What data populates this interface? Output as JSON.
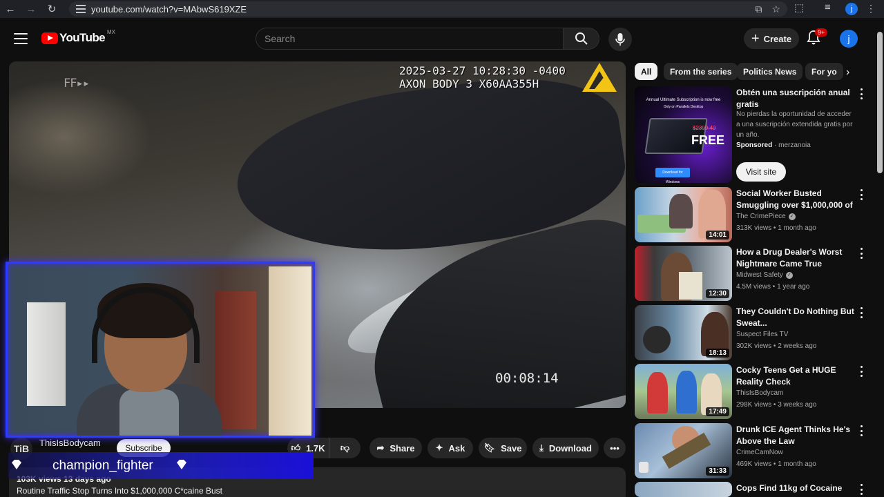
{
  "browser": {
    "url": "youtube.com/watch?v=MAbwS619XZE",
    "profile_initial": "j"
  },
  "header": {
    "logo_text": "YouTube",
    "country_code": "MX",
    "search_placeholder": "Search",
    "create_label": "Create",
    "notifications_badge": "9+",
    "avatar_initial": "j"
  },
  "video": {
    "overlay_ff": "FF▸▸",
    "timestamp_line1": "2025-03-27 10:28:30 -0400",
    "timestamp_line2": "AXON BODY 3 X60AA355H",
    "elapsed": "00:08:14",
    "accent_color": "#f2c416"
  },
  "stream_overlay": {
    "username": "champion_fighter",
    "frame_color": "#2b3cff"
  },
  "below_video": {
    "channel_initials": "TiB",
    "channel_name": "ThisIsBodycam",
    "subscribe_label": "Subscribe",
    "likes": "1.7K",
    "share_label": "Share",
    "ask_label": "Ask",
    "save_label": "Save",
    "download_label": "Download",
    "views_date": "103K views  13 days ago",
    "title": "Routine Traffic Stop Turns Into $1,000,000 C*caine Bust"
  },
  "chips": [
    {
      "label": "All",
      "active": true
    },
    {
      "label": "From the series",
      "active": false
    },
    {
      "label": "Politics News",
      "active": false
    },
    {
      "label": "For yo",
      "active": false
    }
  ],
  "ad": {
    "title": "Obtén una suscripción anual gratis",
    "description": "No pierdas la oportunidad de acceder a una suscripción extendida gratis por un año.",
    "sponsored_label": "Sponsored",
    "advertiser": "merzanoia",
    "visit_label": "Visit site",
    "thumb_headline": "Annual Ultimate Subscription is now free",
    "thumb_sub": "Only on Parallels Desktop",
    "thumb_price": "$2399.40",
    "thumb_free": "FREE",
    "thumb_download": "Download for Windows"
  },
  "recommendations": [
    {
      "title": "Social Worker Busted Smuggling over $1,000,000 of ...",
      "channel": "The CrimePiece",
      "verified": true,
      "stats": "313K views • 1 month ago",
      "duration": "14:01"
    },
    {
      "title": "How a Drug Dealer's Worst Nightmare Came True",
      "channel": "Midwest Safety",
      "verified": true,
      "stats": "4.5M views • 1 year ago",
      "duration": "12:30"
    },
    {
      "title": "They Couldn't Do Nothing But Sweat...",
      "channel": "Suspect Files TV",
      "verified": false,
      "stats": "302K views • 2 weeks ago",
      "duration": "18:13"
    },
    {
      "title": "Cocky Teens Get a HUGE Reality Check",
      "channel": "ThisIsBodycam",
      "verified": false,
      "stats": "298K views • 3 weeks ago",
      "duration": "17:49"
    },
    {
      "title": "Drunk ICE Agent Thinks He's Above the Law",
      "channel": "CrimeCamNow",
      "verified": false,
      "stats": "469K views • 1 month ago",
      "duration": "31:33"
    },
    {
      "title": "Cops Find 11kg of Cocaine",
      "channel": "",
      "verified": false,
      "stats": "",
      "duration": ""
    }
  ]
}
